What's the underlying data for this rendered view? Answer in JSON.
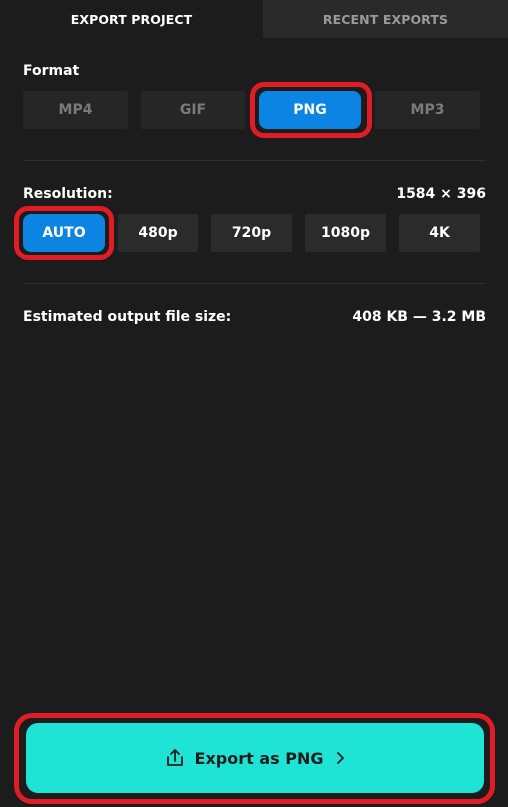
{
  "tabs": [
    {
      "label": "EXPORT PROJECT",
      "active": true
    },
    {
      "label": "RECENT EXPORTS",
      "active": false
    }
  ],
  "format": {
    "label": "Format",
    "options": [
      "MP4",
      "GIF",
      "PNG",
      "MP3"
    ],
    "selected": "PNG"
  },
  "resolution": {
    "label": "Resolution:",
    "dimensions": "1584 × 396",
    "options": [
      "AUTO",
      "480p",
      "720p",
      "1080p",
      "4K"
    ],
    "selected": "AUTO"
  },
  "file_size": {
    "label": "Estimated output file size:",
    "value": "408 KB — 3.2 MB"
  },
  "export_button": {
    "label": "Export as PNG",
    "icon": "share-upload-icon",
    "chevron": "chevron-right-icon"
  },
  "colors": {
    "background": "#1c1c1c",
    "selected": "#0b84e3",
    "export": "#1ee3d5",
    "highlight": "#e01c24"
  }
}
